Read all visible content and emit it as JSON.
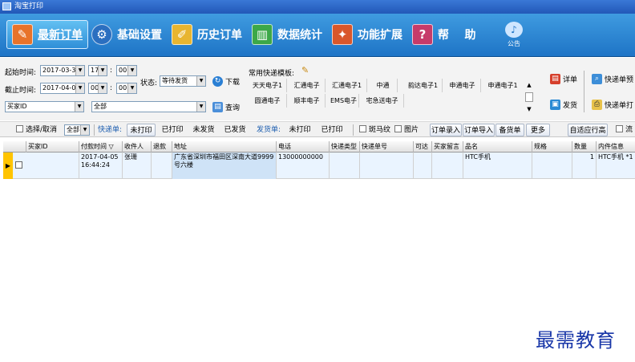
{
  "window": {
    "title": "淘宝打印"
  },
  "nav": {
    "items": [
      {
        "label": "最新订单",
        "icon": "new-orders-icon",
        "active": true
      },
      {
        "label": "基础设置",
        "icon": "settings-gear-icon",
        "active": false
      },
      {
        "label": "历史订单",
        "icon": "history-orders-icon",
        "active": false
      },
      {
        "label": "数据统计",
        "icon": "statistics-chart-icon",
        "active": false
      },
      {
        "label": "功能扩展",
        "icon": "extension-icon",
        "active": false
      },
      {
        "label": "帮    助",
        "icon": "help-icon",
        "active": false
      }
    ],
    "announcement": "公告"
  },
  "filters": {
    "start_label": "起始时间:",
    "start_date": "2017-03-31",
    "start_hour": "17",
    "start_minute": "00",
    "end_label": "截止时间:",
    "end_date": "2017-04-07",
    "end_hour": "00",
    "end_minute": "00",
    "status_label": "状态:",
    "status_value": "等待发货",
    "download_label": "下载",
    "query_label": "查询",
    "field_select": "买家ID",
    "field_value": "全部",
    "templates_label": "常用快递模板:",
    "express_templates": [
      "天天电子1",
      "汇通电子",
      "汇通电子1",
      "中通",
      "韵达电子1",
      "申通电子",
      "申通电子1",
      "圆通电子",
      "顺丰电子",
      "EMS电子",
      "宅急送电子"
    ],
    "detail_label": "详单",
    "ship_label": "发货",
    "express_preview_label": "快递单预",
    "express_print_label": "快递单打"
  },
  "toolbar": {
    "select_toggle": "选择/取消",
    "scope_value": "全部",
    "express_label": "快递单:",
    "unprinted": "未打印",
    "printed": "已打印",
    "not_shipped": "未发货",
    "shipped": "已发货",
    "invoice_label": "发货单:",
    "invoice_unprinted": "未打印",
    "invoice_printed": "已打印",
    "zebra": "斑马纹",
    "image": "图片",
    "order_entry": "订单录入",
    "order_import": "订单导入",
    "stock_list": "备货单",
    "more": "更多",
    "auto_fit": "自适应行高",
    "trailing_check": "流"
  },
  "grid": {
    "columns": [
      "买家ID",
      "付款时间",
      "收件人",
      "退款",
      "地址",
      "电话",
      "快递类型",
      "快递单号",
      "可达",
      "买家留言",
      "品名",
      "规格",
      "数量",
      "内件信息"
    ],
    "sort_arrow": "▽",
    "rows": [
      {
        "buyer_id": "",
        "pay_time": "2017-04-05 16:44:24",
        "recipient": "张珊",
        "refund": "",
        "address": "广东省深圳市福田区深南大道9999号六楼",
        "phone": "13000000000",
        "express_type": "",
        "tracking": "",
        "reachable": "",
        "message": "",
        "product": "HTC手机",
        "spec": "",
        "qty": "1",
        "contents": "HTC手机 *1"
      }
    ]
  },
  "watermark": "最需教育",
  "colors": {
    "nav_bg": "#1e74c6",
    "row_selected": "#eaf4ff",
    "row_marker": "#ffc400",
    "watermark": "#1836a8"
  }
}
